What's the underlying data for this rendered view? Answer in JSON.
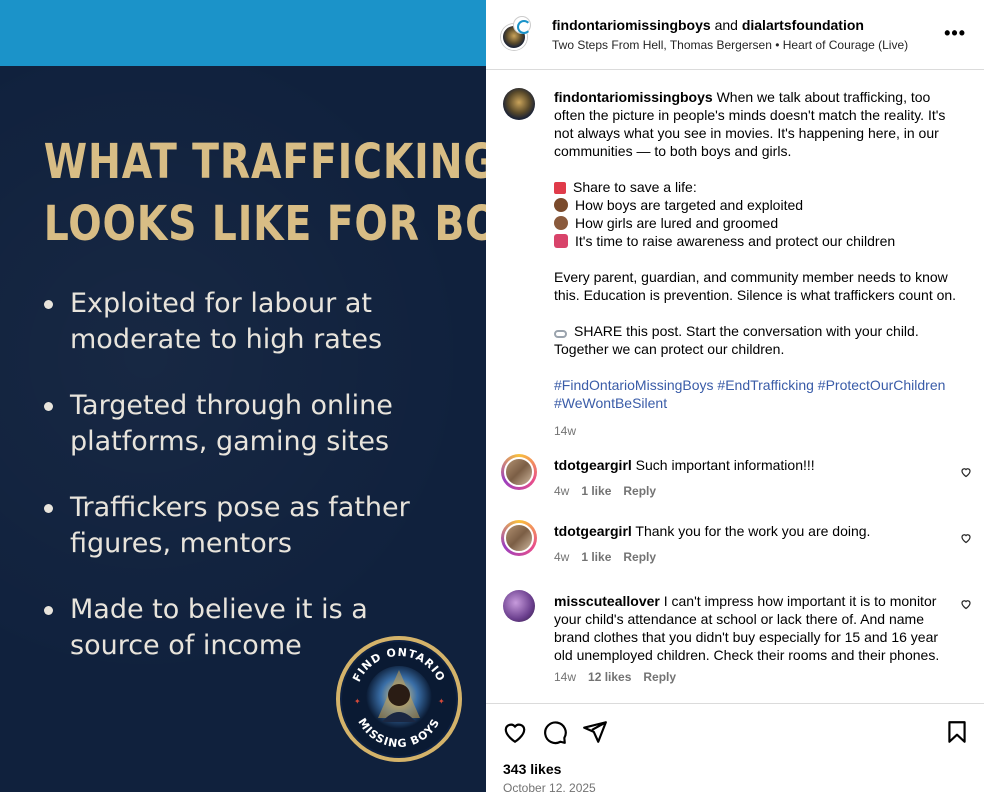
{
  "image": {
    "title_line1": "WHAT TRAFFICKING",
    "title_line2": "LOOKS LIKE FOR BOYS",
    "bullets": [
      {
        "line1": "Exploited for labour at",
        "line2": "moderate to high rates"
      },
      {
        "line1": "Targeted through online",
        "line2": "platforms, gaming sites"
      },
      {
        "line1": "Traffickers pose as father",
        "line2": "figures, mentors"
      },
      {
        "line1": "Made to believe it is a",
        "line2": "source of income"
      }
    ],
    "badge_top_text": "FIND ONTARIO",
    "badge_bottom_text": "MISSING BOYS",
    "colors": {
      "top_band": "#1b93c9",
      "background": "#10213d",
      "title": "#d8bd85",
      "bullet_text": "#e8e4dc"
    }
  },
  "header": {
    "user1": "findontariomissingboys",
    "joiner": " and ",
    "user2": "dialartsfoundation",
    "audio": "Two Steps From Hell, Thomas Bergersen • Heart of Courage (Live)",
    "more_icon": "more-horizontal-icon"
  },
  "caption": {
    "user": "findontariomissingboys",
    "intro": "When we talk about trafficking, too often the picture in people's minds doesn't match the reality. It's not always what you see in movies. It's happening here, in our communities — to both boys and girls.",
    "list": [
      {
        "icon": "flag-emoji",
        "text": "Share to save a life:"
      },
      {
        "icon": "boy-emoji",
        "text": "How boys are targeted and exploited"
      },
      {
        "icon": "girl-emoji",
        "text": "How girls are lured and groomed"
      },
      {
        "icon": "megaphone-emoji",
        "text": "It's time to raise awareness and protect our children"
      }
    ],
    "para2": "Every parent, guardian, and community member needs to know this. Education is prevention. Silence is what traffickers count on.",
    "share_icon": "link-emoji",
    "para3": "SHARE this post. Start the conversation with your child. Together we can protect our children.",
    "hashtags": [
      "#FindOntarioMissingBoys",
      "#EndTrafficking",
      "#ProtectOurChildren",
      "#WeWontBeSilent"
    ],
    "time": "14w"
  },
  "comments": [
    {
      "user": "tdotgeargirl",
      "text": "Such important information!!!",
      "time": "4w",
      "likes": "1 like",
      "reply": "Reply"
    },
    {
      "user": "tdotgeargirl",
      "text": "Thank you for the work you are doing.",
      "time": "4w",
      "likes": "1 like",
      "reply": "Reply"
    },
    {
      "user": "misscuteallover",
      "text": "I can't impress how important it is to monitor your child's attendance at school or lack there of. And name brand clothes that you didn't buy especially for 15 and 16 year old unemployed children. Check their rooms and their phones.",
      "time": "14w",
      "likes": "12 likes",
      "reply": "Reply"
    }
  ],
  "footer": {
    "likes": "343 likes",
    "date": "October 12, 2025"
  }
}
